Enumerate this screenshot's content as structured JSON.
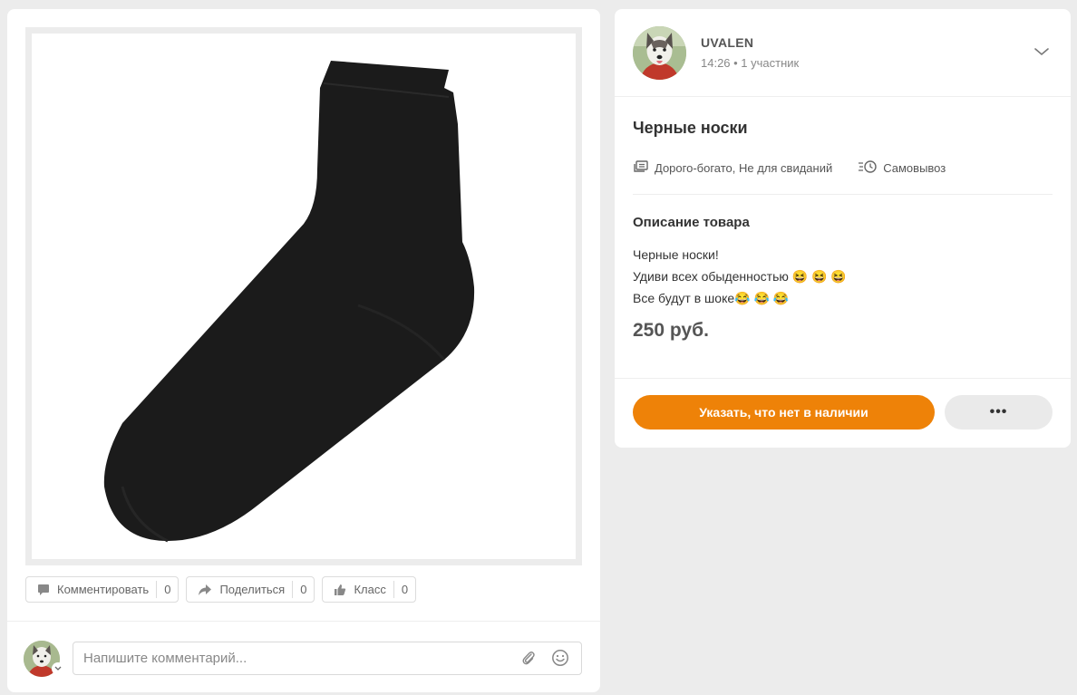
{
  "post": {
    "image_alt": "black sock"
  },
  "actions": {
    "comment_label": "Комментировать",
    "comment_count": "0",
    "share_label": "Поделиться",
    "share_count": "0",
    "like_label": "Класс",
    "like_count": "0"
  },
  "comment_box": {
    "placeholder": "Напишите комментарий..."
  },
  "author": {
    "name": "UVALEN",
    "meta": "14:26 • 1 участник"
  },
  "product": {
    "title": "Черные носки",
    "tags": "Дорого-богато, Не для свиданий",
    "delivery": "Самовывоз",
    "description_heading": "Описание товара",
    "description_lines": [
      "Черные носки!",
      "Удиви всех обыденностью 😆 😆 😆",
      "Все будут в шоке😂 😂 😂"
    ],
    "price": "250 руб."
  },
  "buttons": {
    "primary_label": "Указать, что нет в наличии",
    "more_label": "•••"
  },
  "colors": {
    "accent": "#ee8208",
    "background": "#ececec"
  },
  "icons": {
    "comment": "comment-icon",
    "share": "share-arrow-icon",
    "like": "thumbs-up-icon",
    "attach": "paperclip-icon",
    "emoji": "smile-icon",
    "chevron": "chevron-down-icon",
    "tags": "tags-stack-icon",
    "delivery": "pickup-clock-icon"
  }
}
